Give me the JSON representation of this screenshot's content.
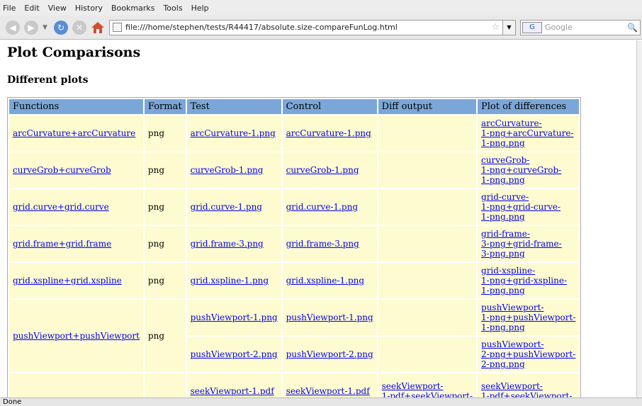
{
  "menu": [
    "File",
    "Edit",
    "View",
    "History",
    "Bookmarks",
    "Tools",
    "Help"
  ],
  "toolbar": {
    "url": "file:///home/stephen/tests/R44417/absolute.size-compareFunLog.html",
    "search_placeholder": "Google",
    "search_engine": "G"
  },
  "page": {
    "title": "Plot Comparisons",
    "subtitle": "Different plots"
  },
  "table": {
    "headers": [
      "Functions",
      "Format",
      "Test",
      "Control",
      "Diff output",
      "Plot of differences"
    ],
    "groups": [
      {
        "function": "arcCurvature+arcCurvature",
        "format": "png",
        "rows": [
          {
            "test": "arcCurvature-1.png",
            "control": "arcCurvature-1.png",
            "diff": "",
            "plot": [
              "arcCurvature-",
              "1-png+arcCurvature-",
              "1-png.png"
            ]
          }
        ]
      },
      {
        "function": "curveGrob+curveGrob",
        "format": "png",
        "rows": [
          {
            "test": "curveGrob-1.png",
            "control": "curveGrob-1.png",
            "diff": "",
            "plot": [
              "curveGrob-",
              "1-png+curveGrob-",
              "1-png.png"
            ]
          }
        ]
      },
      {
        "function": "grid.curve+grid.curve",
        "format": "png",
        "rows": [
          {
            "test": "grid.curve-1.png",
            "control": "grid.curve-1.png",
            "diff": "",
            "plot": [
              "grid-curve-",
              "1-png+grid-curve-",
              "1-png.png"
            ]
          }
        ]
      },
      {
        "function": "grid.frame+grid.frame",
        "format": "png",
        "rows": [
          {
            "test": "grid.frame-3.png",
            "control": "grid.frame-3.png",
            "diff": "",
            "plot": [
              "grid-frame-",
              "3-png+grid-frame-",
              "3-png.png"
            ]
          }
        ]
      },
      {
        "function": "grid.xspline+grid.xspline",
        "format": "png",
        "rows": [
          {
            "test": "grid.xspline-1.png",
            "control": "grid.xspline-1.png",
            "diff": "",
            "plot": [
              "grid-xspline-",
              "1-png+grid-xspline-",
              "1-png.png"
            ]
          }
        ]
      },
      {
        "function": "pushViewport+pushViewport",
        "format": "png",
        "rows": [
          {
            "test": "pushViewport-1.png",
            "control": "pushViewport-1.png",
            "diff": "",
            "plot": [
              "pushViewport-",
              "1-png+pushViewport-",
              "1-png.png"
            ]
          },
          {
            "test": "pushViewport-2.png",
            "control": "pushViewport-2.png",
            "diff": "",
            "plot": [
              "pushViewport-",
              "2-png+pushViewport-",
              "2-png.png"
            ]
          }
        ]
      },
      {
        "function": "",
        "format": "",
        "rows": [
          {
            "test": "seekViewport-1.pdf",
            "control": "seekViewport-1.pdf",
            "diff": [
              "seekViewport-",
              "1-pdf+seekViewport-"
            ],
            "plot": [
              "seekViewport-",
              "1-pdf+seekViewport-"
            ]
          }
        ]
      }
    ]
  },
  "status": "Done"
}
